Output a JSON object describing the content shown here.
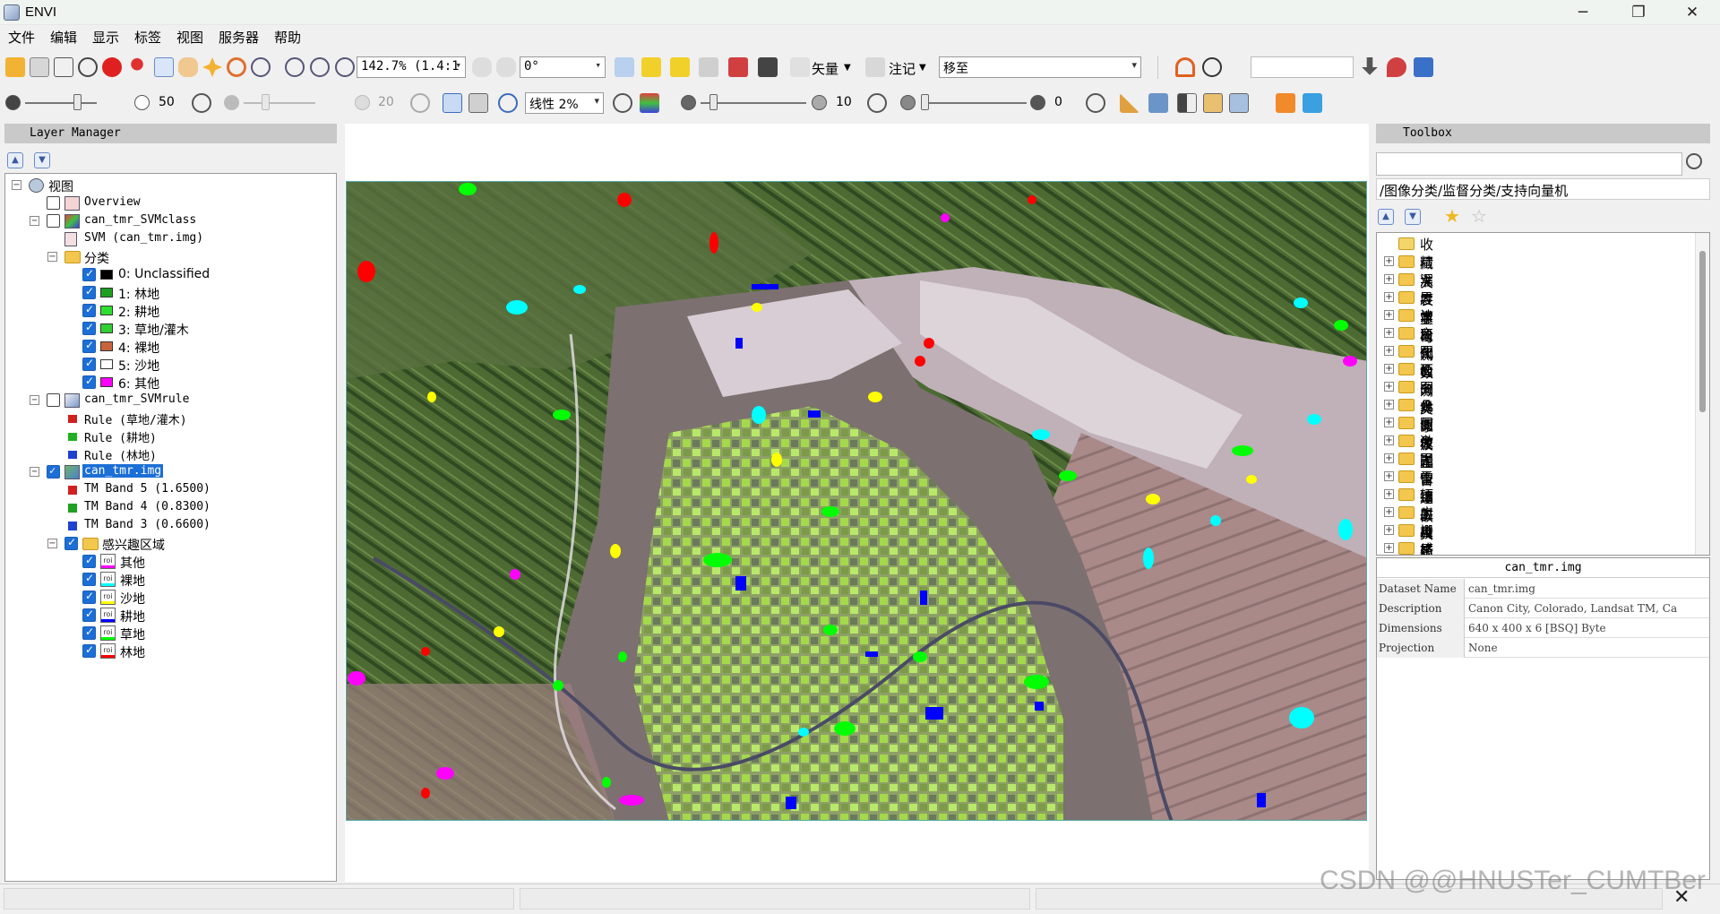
{
  "window": {
    "title": "ENVI",
    "minimize": "─",
    "maximize": "❐",
    "close": "✕"
  },
  "menu": [
    "文件",
    "编辑",
    "显示",
    "标签",
    "视图",
    "服务器",
    "帮助"
  ],
  "toolbar": {
    "zoom": "142.7% (1.4:1",
    "rotation": "0°",
    "vector_label": "矢量",
    "annotation_label": "注记",
    "goto_value": "移至",
    "brightness": "50",
    "contrast": "20",
    "stretch": "线性 2%",
    "sharpen": "10",
    "transparency": "0"
  },
  "layer_manager": {
    "title": "Layer Manager",
    "root": "视图",
    "overview": "Overview",
    "svm_class": {
      "name": "can_tmr_SVMclass",
      "child": "SVM (can_tmr.img)",
      "folder": "分类",
      "classes": [
        {
          "label": "0: Unclassified",
          "color": "#000000"
        },
        {
          "label": "1: 林地",
          "color": "#1ea01e"
        },
        {
          "label": "2: 耕地",
          "color": "#2ee02e"
        },
        {
          "label": "3: 草地/灌木",
          "color": "#30d030"
        },
        {
          "label": "4: 裸地",
          "color": "#c8643c"
        },
        {
          "label": "5: 沙地",
          "color": "#ffffff"
        },
        {
          "label": "6: 其他",
          "color": "#ff00ff"
        }
      ]
    },
    "svm_rule": {
      "name": "can_tmr_SVMrule",
      "rules": [
        {
          "label": "Rule (草地/灌木)",
          "color": "#d02020"
        },
        {
          "label": "Rule (耕地)",
          "color": "#20b020"
        },
        {
          "label": "Rule (林地)",
          "color": "#2040d0"
        }
      ]
    },
    "image": {
      "name": "can_tmr.img",
      "bands": [
        {
          "label": "TM Band 5 (1.6500)",
          "color": "#d02020"
        },
        {
          "label": "TM Band 4 (0.8300)",
          "color": "#20a020"
        },
        {
          "label": "TM Band 3 (0.6600)",
          "color": "#2040d0"
        }
      ],
      "roi_folder": "感兴趣区域",
      "rois": [
        {
          "label": "其他",
          "color": "#ff00ff"
        },
        {
          "label": "裸地",
          "color": "#00ffff"
        },
        {
          "label": "沙地",
          "color": "#ffff00"
        },
        {
          "label": "耕地",
          "color": "#0000ff"
        },
        {
          "label": "草地",
          "color": "#00ff00"
        },
        {
          "label": "林地",
          "color": "#ff0000"
        }
      ]
    }
  },
  "toolbox": {
    "title": "Toolbox",
    "path": "/图像分类/监督分类/支持向量机",
    "items": [
      "收藏夹",
      "精准农业",
      "深度学习",
      "异常检测",
      "波段代数",
      "变化检测",
      "图像分类",
      "面向对象",
      "图像滤波",
      "几何校正",
      "图像融合",
      "激光雷达",
      "图像镶嵌",
      "雷达工具",
      "辐射校正",
      "应用商店",
      "栅格管理",
      "感兴趣区"
    ]
  },
  "properties": {
    "title": "can_tmr.img",
    "rows": [
      {
        "key": "Dataset Name",
        "value": "can_tmr.img"
      },
      {
        "key": "Description",
        "value": "Canon City, Colorado, Landsat TM, Ca"
      },
      {
        "key": "Dimensions",
        "value": "640 x 400 x 6 [BSQ] Byte"
      },
      {
        "key": "Projection",
        "value": "None"
      }
    ]
  },
  "watermark": "CSDN @@HNUSTer_CUMTBer"
}
